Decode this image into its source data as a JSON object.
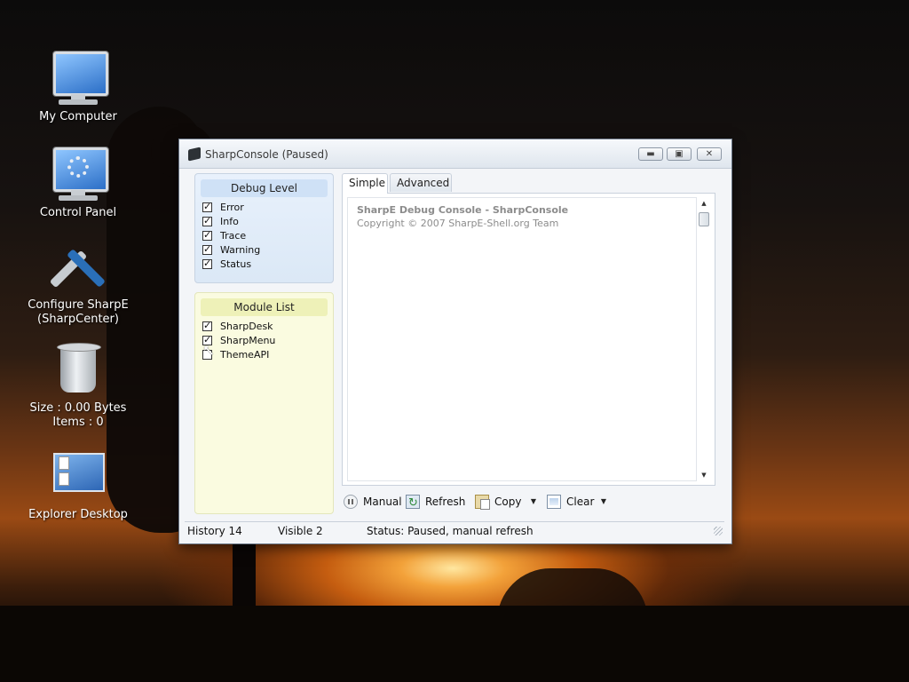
{
  "desktop": {
    "icons": [
      {
        "label": "My Computer",
        "icon": "computer-icon"
      },
      {
        "label": "Control Panel",
        "icon": "control-panel-icon"
      },
      {
        "label": "Configure SharpE\n(SharpCenter)",
        "icon": "tools-icon"
      },
      {
        "label": "Size : 0.00 Bytes\nItems : 0",
        "icon": "recycle-bin-icon"
      },
      {
        "label": "Explorer Desktop",
        "icon": "explorer-desktop-icon"
      }
    ]
  },
  "window": {
    "title": "SharpConsole (Paused)",
    "buttons": {
      "minimize": "minimize-icon",
      "maximize": "maximize-icon",
      "close": "close-icon"
    }
  },
  "debug_level": {
    "title": "Debug Level",
    "items": [
      {
        "label": "Error",
        "checked": true
      },
      {
        "label": "Info",
        "checked": true
      },
      {
        "label": "Trace",
        "checked": true
      },
      {
        "label": "Warning",
        "checked": true
      },
      {
        "label": "Status",
        "checked": true
      }
    ]
  },
  "module_list": {
    "title": "Module List",
    "items": [
      {
        "label": "SharpDesk",
        "checked": true
      },
      {
        "label": "SharpMenu",
        "checked": true
      },
      {
        "label": "ThemeAPI",
        "checked": false
      }
    ]
  },
  "tabs": [
    {
      "label": "Simple",
      "active": true
    },
    {
      "label": "Advanced",
      "active": false
    }
  ],
  "console": {
    "lines": [
      "SharpE Debug Console - SharpConsole",
      "Copyright © 2007 SharpE-Shell.org Team"
    ]
  },
  "toolbar": {
    "manual": "Manual",
    "refresh": "Refresh",
    "copy": "Copy",
    "clear": "Clear"
  },
  "statusbar": {
    "history": "History 14",
    "visible": "Visible 2",
    "status": "Status: Paused, manual refresh"
  },
  "colors": {
    "debug_panel": "#dbe8f6",
    "module_panel": "#fafbe0",
    "window_bg": "#f3f5f8"
  }
}
